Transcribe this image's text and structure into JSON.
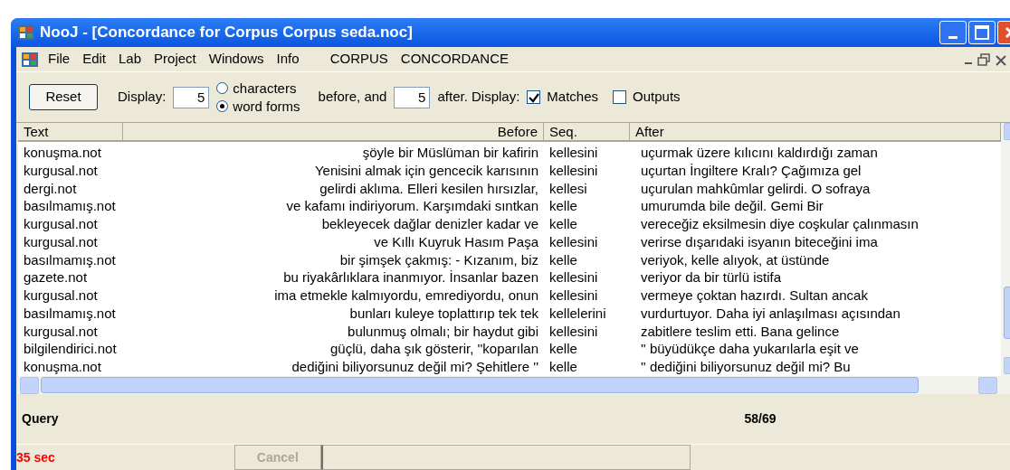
{
  "window": {
    "title": "NooJ - [Concordance for Corpus Corpus seda.noc]"
  },
  "menu": [
    "File",
    "Edit",
    "Lab",
    "Project",
    "Windows",
    "Info",
    "CORPUS",
    "CONCORDANCE"
  ],
  "toolbar": {
    "reset": "Reset",
    "display_label": "Display:",
    "before_count": "5",
    "units": [
      {
        "label": "characters",
        "selected": false
      },
      {
        "label": "word forms",
        "selected": true
      }
    ],
    "before_label": "before, and",
    "after_count": "5",
    "after_label": "after.  Display:",
    "options": [
      {
        "label": "Matches",
        "checked": true
      },
      {
        "label": "Outputs",
        "checked": false
      }
    ]
  },
  "table": {
    "columns": [
      "Text",
      "Before",
      "Seq.",
      "After"
    ],
    "rows": [
      [
        "konuşma.not",
        "şöyle bir Müslüman bir kafirin",
        "kellesini",
        "uçurmak üzere kılıcını kaldırdığı zaman"
      ],
      [
        "kurgusal.not",
        "Yenisini almak için gencecik karısının",
        "kellesini",
        "uçurtan İngiltere Kralı? Çağımıza gel"
      ],
      [
        "dergi.not",
        "gelirdi aklıma. Elleri kesilen hırsızlar,",
        "kellesi",
        "uçurulan mahkûmlar gelirdi. O sofraya"
      ],
      [
        "basılmamış.not",
        "ve kafamı indiriyorum. Karşımdaki sıntkan",
        "kelle",
        "umurumda bile değil.  Gemi Bir"
      ],
      [
        "kurgusal.not",
        "bekleyecek dağlar denizler kadar ve",
        "kelle",
        "vereceğiz eksilmesin diye coşkular çalınmasın"
      ],
      [
        "kurgusal.not",
        "ve Kıllı Kuyruk Hasım Paşa",
        "kellesini",
        "verirse dışarıdaki isyanın biteceğini ima"
      ],
      [
        "basılmamış.not",
        "bir şimşek çakmış: - Kızanım, biz",
        "kelle",
        "veriyok, kelle alıyok, at üstünde"
      ],
      [
        "gazete.not",
        "bu riyakârlıklara inanmıyor. İnsanlar bazen",
        "kellesini",
        "veriyor da bir türlü istifa"
      ],
      [
        "kurgusal.not",
        "ima etmekle kalmıyordu, emrediyordu, onun",
        "kellesini",
        "vermeye çoktan hazırdı. Sultan ancak"
      ],
      [
        "basılmamış.not",
        "bunları kuleye toplattırıp tek tek",
        "kellelerini",
        "vurdurtuyor. Daha iyi anlaşılması açısından"
      ],
      [
        "kurgusal.not",
        "bulunmuş olmalı; bir haydut gibi",
        "kellesini",
        "zabitlere teslim etti. Bana gelince"
      ],
      [
        "bilgilendirici.not",
        "güçlü, daha şık gösterir, ''koparılan",
        "kelle",
        "'' büyüdükçe daha yukarılarla eşit ve"
      ],
      [
        "konuşma.not",
        "dediğini biliyorsunuz değil mi? Şehitlere ''",
        "kelle",
        "'' dediğini biliyorsunuz değil mi? Bu"
      ]
    ]
  },
  "query": {
    "label": "Query",
    "count": "58/69"
  },
  "status": {
    "time": "35 sec",
    "cancel": {
      "label": "Cancel",
      "disabled": true
    }
  }
}
